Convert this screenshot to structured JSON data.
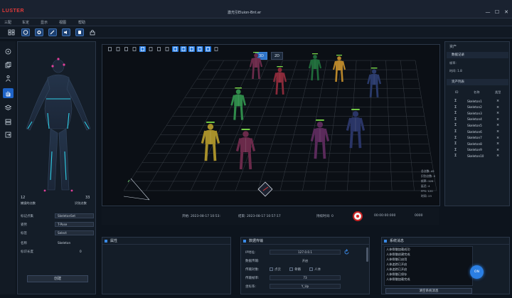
{
  "app": {
    "logo": "LUSTER",
    "title": "激光引Eluion-Bnt.er"
  },
  "window_controls": {
    "minimize": "—",
    "maximize": "☐",
    "close": "✕"
  },
  "menu": [
    "三配",
    "车定",
    "显示",
    "视图",
    "帮助"
  ],
  "toolbar_icons": [
    "grid-icon",
    "refresh-icon",
    "settings-icon",
    "wrench-icon",
    "speaker-icon",
    "hand-icon",
    "lock-icon"
  ],
  "left_rail_icons": [
    "target-icon",
    "copy-icon",
    "person-icon",
    "hand-active-icon",
    "layers-icon",
    "stack-icon",
    "export-icon"
  ],
  "left_panel": {
    "left_count": "12",
    "right_count": "33",
    "left_label": "捕捉的点数",
    "right_label": "识别点数",
    "props": [
      {
        "label": "标记点集",
        "value": "SkeletonSet"
      },
      {
        "label": "姿势",
        "value": "T-Pose"
      },
      {
        "label": "标签",
        "value": "Select"
      },
      {
        "label": "名称",
        "value": "Skeleton"
      },
      {
        "label": "标识长度",
        "value": "0"
      }
    ],
    "apply_button": "创建"
  },
  "viewport": {
    "tabs": [
      "3D",
      "2D"
    ],
    "toolbar_buttons": [
      "select",
      "move",
      "rotate",
      "scale",
      "frame",
      "camera",
      "pointer",
      "zoom",
      "measure",
      "grid",
      "axes",
      "markers",
      "bones",
      "labels"
    ],
    "stats": [
      "总点数: 45",
      "识别点数: 0",
      "帧率: 120",
      "延迟: 4",
      "FPS: 120",
      "时间: 23"
    ]
  },
  "right_panel": {
    "header": "资产",
    "section1": "数据记录",
    "info_line1": "帧率:",
    "info_line2": "时间: 1.8",
    "section2": "资产列表",
    "col_id": "ID",
    "col_name": "名称",
    "col_icon": "类型",
    "assets": [
      "Skeleton1",
      "Skeleton2",
      "Skeleton3",
      "Skeleton4",
      "Skeleton5",
      "Skeleton6",
      "Skeleton7",
      "Skeleton8",
      "Skeleton9",
      "Skeleton10"
    ]
  },
  "timeline": {
    "start_label": "开始: 2023-08-17 10:53:",
    "end_label": "结束: 2023-08-17 10:57:17",
    "duration_label": "持续时间: 0",
    "time_value": "00:00:00:000",
    "frame_value": "0000"
  },
  "panes": {
    "attributes": {
      "title": "属性"
    },
    "data_transfer": {
      "title": "数据传输",
      "fields": [
        {
          "label": "IP地址:",
          "value": "127.0.0.1"
        },
        {
          "label": "数据传输:",
          "value": "开启"
        },
        {
          "label": "传输对象:",
          "value": ""
        },
        {
          "label": "传输帧率:",
          "value": "73"
        },
        {
          "label": "坐标系:",
          "value": "Y_Up"
        }
      ],
      "checkboxes": [
        "点云",
        "骨骼",
        "人体"
      ]
    },
    "system_log": {
      "title": "系统消息",
      "lines": [
        "人体骨骼加载成功",
        "人体骨骼创建完成",
        "人体骨骼已启用",
        "人体追踪已开启",
        "人体追踪已开启",
        "人体骨骼已保存",
        "人体骨骼加载完成",
        "人体骨骼已连接"
      ],
      "clear_button": "清空系统消息",
      "badge": "ON"
    }
  },
  "colors": {
    "accent": "#2a7de1",
    "record": "#d22222",
    "bg": "#0d141d"
  }
}
